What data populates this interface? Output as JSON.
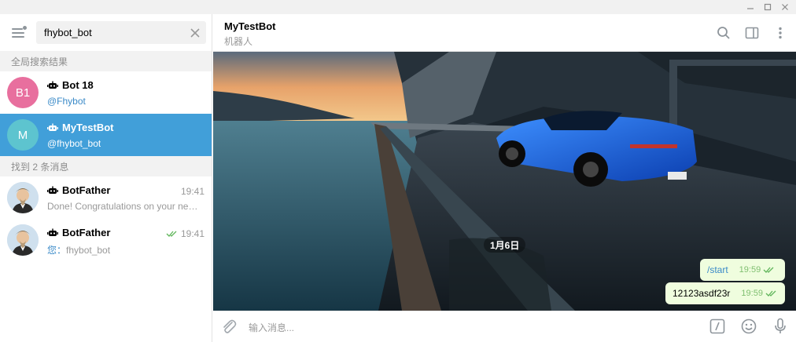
{
  "window": {
    "controls": [
      "minimize",
      "maximize",
      "close"
    ]
  },
  "sidebar": {
    "search": {
      "value": "fhybot_bot"
    },
    "section_global": "全局搜索结果",
    "section_messages": "找到 2 条消息",
    "global_results": [
      {
        "name": "Bot 18",
        "sub": "@Fhybot",
        "avatar_text": "B1",
        "avatar_color": "#e86f9e",
        "is_bot": true
      },
      {
        "name": "MyTestBot",
        "sub": "@fhybot_bot",
        "avatar_text": "M",
        "avatar_color": "#5dc4cf",
        "is_bot": true,
        "active": true
      }
    ],
    "message_results": [
      {
        "name": "BotFather",
        "time": "19:41",
        "sub": "Done! Congratulations on your new ...",
        "is_bot": true
      },
      {
        "name": "BotFather",
        "time": "19:41",
        "sub_prefix": "您：",
        "sub": "fhybot_bot",
        "is_bot": true,
        "read": true
      }
    ]
  },
  "chat": {
    "title": "MyTestBot",
    "status": "机器人",
    "date_separator": "1月6日",
    "messages": [
      {
        "text": "/start",
        "time": "19:59",
        "is_command": true
      },
      {
        "text": "12123asdf23r",
        "time": "19:59",
        "is_command": false
      }
    ],
    "composer_placeholder": "输入消息..."
  },
  "colors": {
    "accent": "#419fd9",
    "link": "#3a8ac8",
    "outgoing_bubble": "#effdde",
    "read_check": "#5fb55a"
  },
  "icons": {
    "header": [
      "search-icon",
      "sidebar-toggle-icon",
      "more-icon"
    ],
    "composer": [
      "attach-icon",
      "bot-command-icon",
      "emoji-icon",
      "microphone-icon"
    ]
  }
}
